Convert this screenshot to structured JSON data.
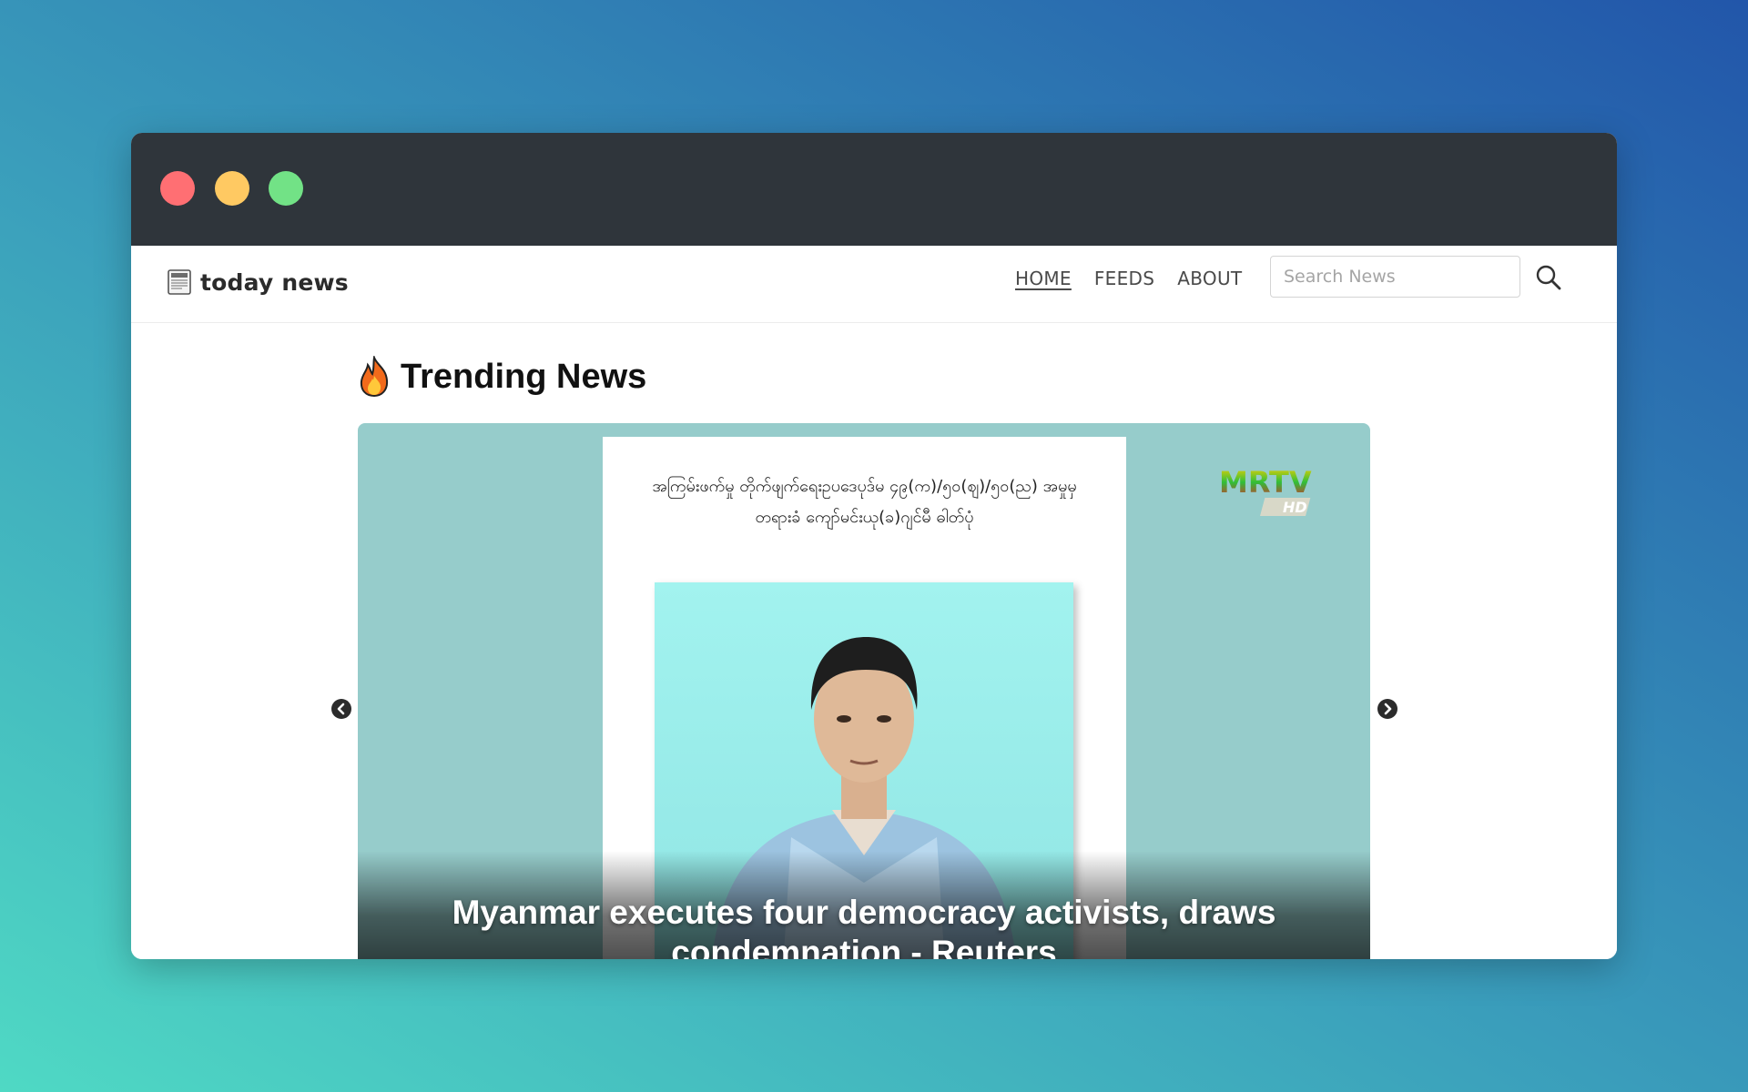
{
  "window": {
    "controls": [
      "close",
      "minimize",
      "maximize"
    ],
    "colors": {
      "close": "#ff6f73",
      "minimize": "#ffc962",
      "maximize": "#72e286",
      "titlebar": "#2f353b"
    }
  },
  "navbar": {
    "brand_icon": "newspaper-icon",
    "brand": "today news",
    "links": [
      {
        "label": "HOME",
        "active": true
      },
      {
        "label": "FEEDS",
        "active": false
      },
      {
        "label": "ABOUT",
        "active": false
      }
    ],
    "search": {
      "placeholder": "Search News",
      "value": "",
      "icon": "search-icon"
    }
  },
  "main": {
    "section_icon": "fire-icon",
    "section_title": "Trending News",
    "carousel": {
      "slide": {
        "image_caption_line1": "အကြမ်းဖက်မှု တိုက်ဖျက်ရေးဥပဒေပုဒ်မ ၄၉(က)/၅၀(ဈ)/၅၀(ည) အမှုမှ",
        "image_caption_line2": "တရားခံ ကျော်မင်းယု(ခ)ဂျင်မီ ဓါတ်ပုံ",
        "channel_logo": "MRTV",
        "channel_logo_sub": "HD",
        "headline": "Myanmar executes four democracy activists, draws condemnation - Reuters"
      },
      "prev_icon": "chevron-left-circle-icon",
      "next_icon": "chevron-right-circle-icon"
    }
  }
}
